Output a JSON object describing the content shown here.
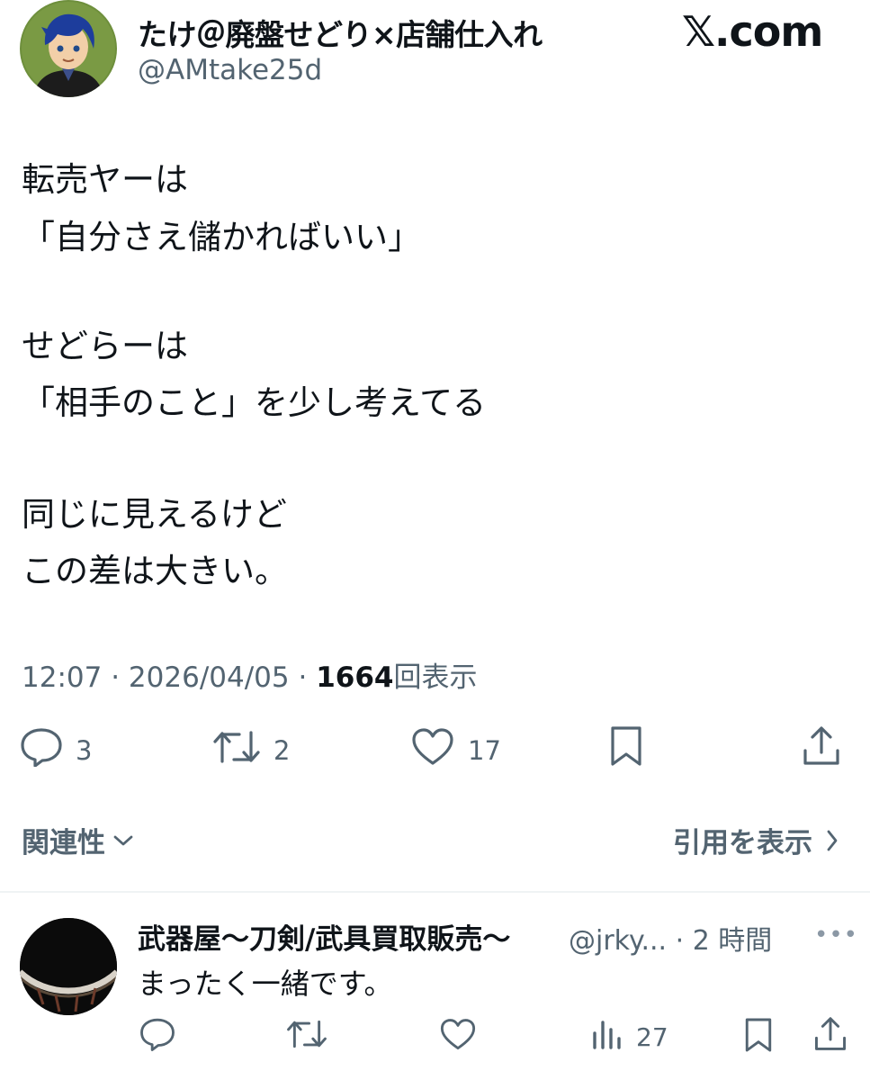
{
  "tweet": {
    "author": {
      "display_name": "たけ＠廃盤せどり×店舗仕入れ",
      "handle": "@AMtake25d"
    },
    "site_mark": "𝕏.com",
    "lines": [
      "転売ヤーは",
      "「自分さえ儲かればいい」",
      "",
      "せどらーは",
      "「相手のこと」を少し考えてる",
      "",
      "同じに見えるけど",
      "この差は大きい。"
    ],
    "time": "12:07",
    "date": "2026/04/05",
    "separator": "·",
    "views_count": "1664",
    "views_label": "回表示",
    "stats": {
      "replies": "3",
      "retweets": "2",
      "likes": "17"
    }
  },
  "filters": {
    "relevance_label": "関連性",
    "quotes_label": "引用を表示"
  },
  "reply": {
    "display_name": "武器屋〜刀剣/武具買取販売〜",
    "handle": "@jrky...",
    "time_ago": "2 時間",
    "text": "まったく一緒です。",
    "views": "27",
    "more": "•••"
  },
  "colors": {
    "text": "#0f1419",
    "secondary": "#536471",
    "divider": "#eff3f4"
  }
}
